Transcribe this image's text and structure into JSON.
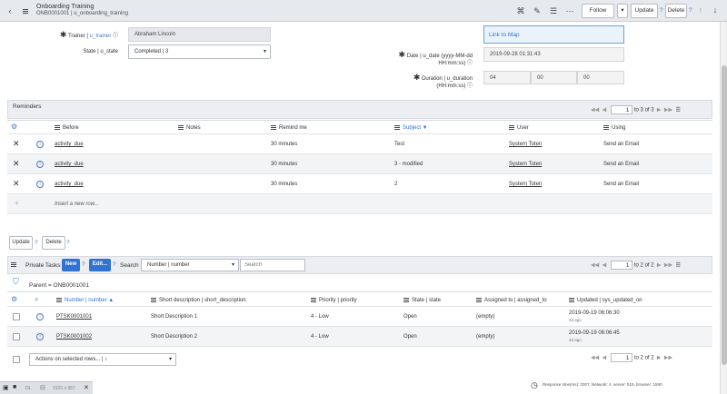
{
  "header": {
    "title": "Onboarding Training",
    "subtitle": "ONB0001001 | u_onboarding_training",
    "follow_label": "Follow",
    "update_label": "Update",
    "delete_label": "Delete",
    "q1": "?",
    "q2": "?"
  },
  "form": {
    "trainer_label": "Trainer",
    "trainer_field": "u_trainer",
    "trainer_value": "Abraham Lincoln",
    "state_label": "State",
    "state_field": "u_state",
    "state_value": "Completed | 3",
    "link_to_map": "Link to Map",
    "date_label": "Date | u_date (yyyy-MM-dd",
    "date_label2": "HH:mm:ss)",
    "date_value": "2019-09-28 01:31:43",
    "duration_label": "Duration | u_duration",
    "duration_label2": "(HH:mm:ss)",
    "duration_h": "04",
    "duration_m": "00",
    "duration_s": "00"
  },
  "reminders": {
    "title": "Reminders",
    "page": "1",
    "page_range": "to 3 of 3",
    "columns": [
      "Before",
      "Notes",
      "Remind me",
      "Subject",
      "User",
      "Using"
    ],
    "rows": [
      {
        "before": "activity_due",
        "notes": "",
        "remind": "30 minutes",
        "subject": "Test",
        "user": "System Toten",
        "using": "Send an Email"
      },
      {
        "before": "activity_due",
        "notes": "",
        "remind": "30 minutes",
        "subject": "3 - modified",
        "user": "System Toten",
        "using": "Send an Email"
      },
      {
        "before": "activity_due",
        "notes": "",
        "remind": "30 minutes",
        "subject": "2",
        "user": "System Toten",
        "using": "Send an Email"
      }
    ],
    "insert_row": "Insert a new row...",
    "plus": "+",
    "update_label": "Update",
    "delete_label": "Delete",
    "q": "?"
  },
  "tasks": {
    "title": "Private Tasks",
    "new_label": "New",
    "edit_label": "Edit...",
    "search_label": "Search",
    "search_field": "Number | number",
    "search_placeholder": "Search",
    "page": "1",
    "page_range": "to 2 of 2",
    "breadcrumb": "Parent = ONB0001001",
    "columns": [
      {
        "label": "Number",
        "field": "number"
      },
      {
        "label": "Short description",
        "field": "short_description"
      },
      {
        "label": "Priority",
        "field": "priority"
      },
      {
        "label": "State",
        "field": "state"
      },
      {
        "label": "Assigned to",
        "field": "assigned_to"
      },
      {
        "label": "Updated",
        "field": "sys_updated_on"
      }
    ],
    "rows": [
      {
        "number": "PTSK0001001",
        "desc": "Short Description 1",
        "priority": "4 - Low",
        "state": "Open",
        "assigned": "(empty)",
        "updated": "2019-09-19 06:06:30",
        "ago": "4d ago"
      },
      {
        "number": "PTSK0001002",
        "desc": "Short Description 2",
        "priority": "4 - Low",
        "state": "Open",
        "assigned": "(empty)",
        "updated": "2019-09-19 06:06:45",
        "ago": "4d ago"
      }
    ],
    "actions_placeholder": "Actions on selected rows... | ↕",
    "footer_page": "1",
    "footer_range": "to 2 of 2"
  },
  "footer": {
    "response_time": "Response time(ms): 2007, Network: 4, server: 515, browser: 1590",
    "dock_text": "DL",
    "dock_size": "1920 x 987"
  }
}
